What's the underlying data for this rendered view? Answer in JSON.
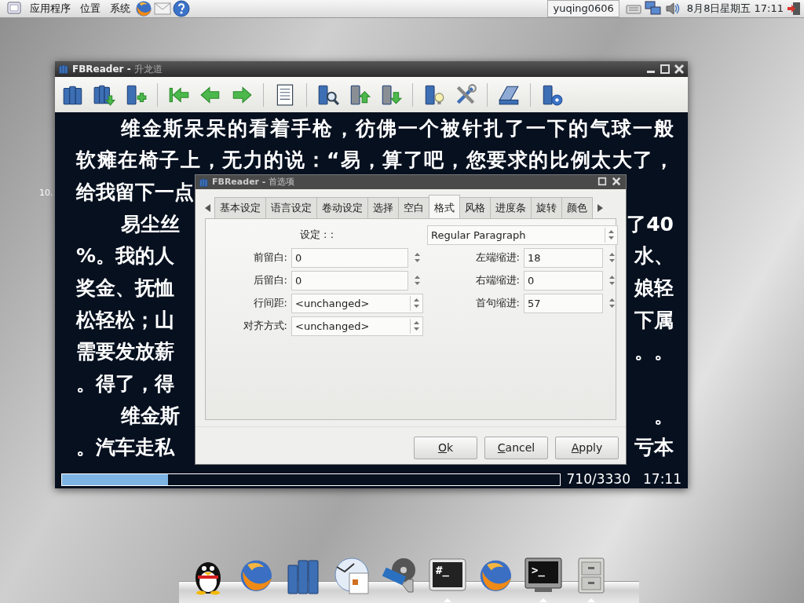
{
  "top_panel": {
    "menus": [
      {
        "label": "应用程序"
      },
      {
        "label": "位置"
      },
      {
        "label": "系统"
      }
    ],
    "user": "yuqing0606",
    "clock": "8月8日星期五 17:11"
  },
  "desktop": {
    "label": "10."
  },
  "window": {
    "app": "FBReader -",
    "document": "升龙道"
  },
  "reader": {
    "lines": [
      {
        "indent": true,
        "left": "维金斯呆呆的看着手枪，彷佛一个被针扎了一下的气球一般"
      },
      {
        "indent": false,
        "left": "软瘫在椅子上，无力的说：“易，算了吧，您要求的比例太大了，"
      },
      {
        "indent": false,
        "left": "给我留下一点"
      },
      {
        "indent": true,
        "left": "易尘丝",
        "right": "了40"
      },
      {
        "indent": false,
        "left": "%。我的人",
        "right": "水、"
      },
      {
        "indent": false,
        "left": "奖金、抚恤",
        "right": "娘轻"
      },
      {
        "indent": false,
        "left": "松轻松；山",
        "right": "下属"
      },
      {
        "indent": false,
        "left": "需要发放薪",
        "right": "。。"
      },
      {
        "indent": false,
        "left": "。得了，得"
      },
      {
        "indent": true,
        "left": "维金斯",
        "right": "。"
      },
      {
        "indent": false,
        "left": "。汽车走私",
        "right": "亏本"
      }
    ],
    "progress": {
      "level": 0.213
    },
    "page": "710/3330",
    "time": "17:11"
  },
  "dialog": {
    "app": "FBReader -",
    "document": "首选项",
    "tabs": [
      {
        "label": "基本设定",
        "selected": false
      },
      {
        "label": "语言设定",
        "selected": false
      },
      {
        "label": "卷动设定",
        "selected": false
      },
      {
        "label": "选择",
        "selected": false
      },
      {
        "label": "空白",
        "selected": false
      },
      {
        "label": "格式",
        "selected": true
      },
      {
        "label": "风格",
        "selected": false
      },
      {
        "label": "进度条",
        "selected": false
      },
      {
        "label": "旋转",
        "selected": false
      },
      {
        "label": "颜色",
        "selected": false
      }
    ],
    "setting": {
      "label": "设定 : :",
      "value": "Regular Paragraph"
    },
    "left_fields": [
      {
        "kind": "spin",
        "label": "前留白:",
        "value": "0"
      },
      {
        "kind": "spin",
        "label": "后留白:",
        "value": "0"
      },
      {
        "kind": "combo",
        "label": "行间距:",
        "value": "<unchanged>"
      },
      {
        "kind": "combo",
        "label": "对齐方式:",
        "value": "<unchanged>"
      }
    ],
    "right_fields": [
      {
        "kind": "spin",
        "label": "左端缩进:",
        "value": "18"
      },
      {
        "kind": "spin",
        "label": "右端缩进:",
        "value": "0"
      },
      {
        "kind": "spin",
        "label": "首句缩进:",
        "value": "57"
      }
    ],
    "buttons": [
      {
        "label": "Ok"
      },
      {
        "label": "Cancel"
      },
      {
        "label": "Apply"
      }
    ]
  },
  "dock": [
    {
      "kind": "penguin",
      "running": false
    },
    {
      "kind": "browser",
      "running": false
    },
    {
      "kind": "books",
      "running": false
    },
    {
      "kind": "office",
      "running": false
    },
    {
      "kind": "media",
      "running": false
    },
    {
      "kind": "terminal",
      "glyph": "#_",
      "running": true
    },
    {
      "kind": "browser",
      "running": false
    },
    {
      "kind": "monitor",
      "glyph": ">_",
      "running": true
    },
    {
      "kind": "cabinet",
      "running": true
    }
  ]
}
